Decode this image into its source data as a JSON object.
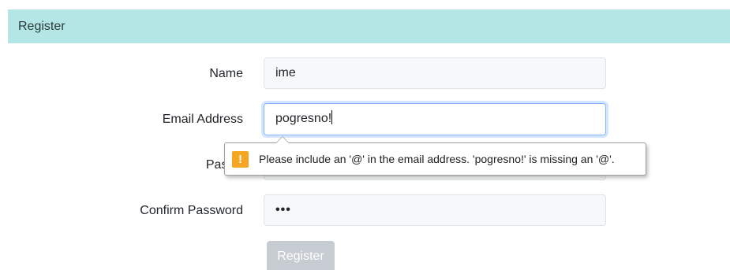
{
  "card": {
    "header_title": "Register"
  },
  "form": {
    "name": {
      "label": "Name",
      "value": "ime"
    },
    "email": {
      "label": "Email Address",
      "value": "pogresno!"
    },
    "password": {
      "label": "Passw",
      "value": ""
    },
    "confirm_password": {
      "label": "Confirm Password",
      "value": "•••"
    },
    "submit_label": "Register"
  },
  "validation_tooltip": {
    "icon": "warning-icon",
    "icon_glyph": "!",
    "message": "Please include an '@' in the email address. 'pogresno!' is missing an '@'."
  },
  "colors": {
    "header_bg": "#b3e6e5",
    "warning": "#f5a623",
    "disabled_button": "#c6ccd2",
    "focus_border": "#86b7fe"
  }
}
